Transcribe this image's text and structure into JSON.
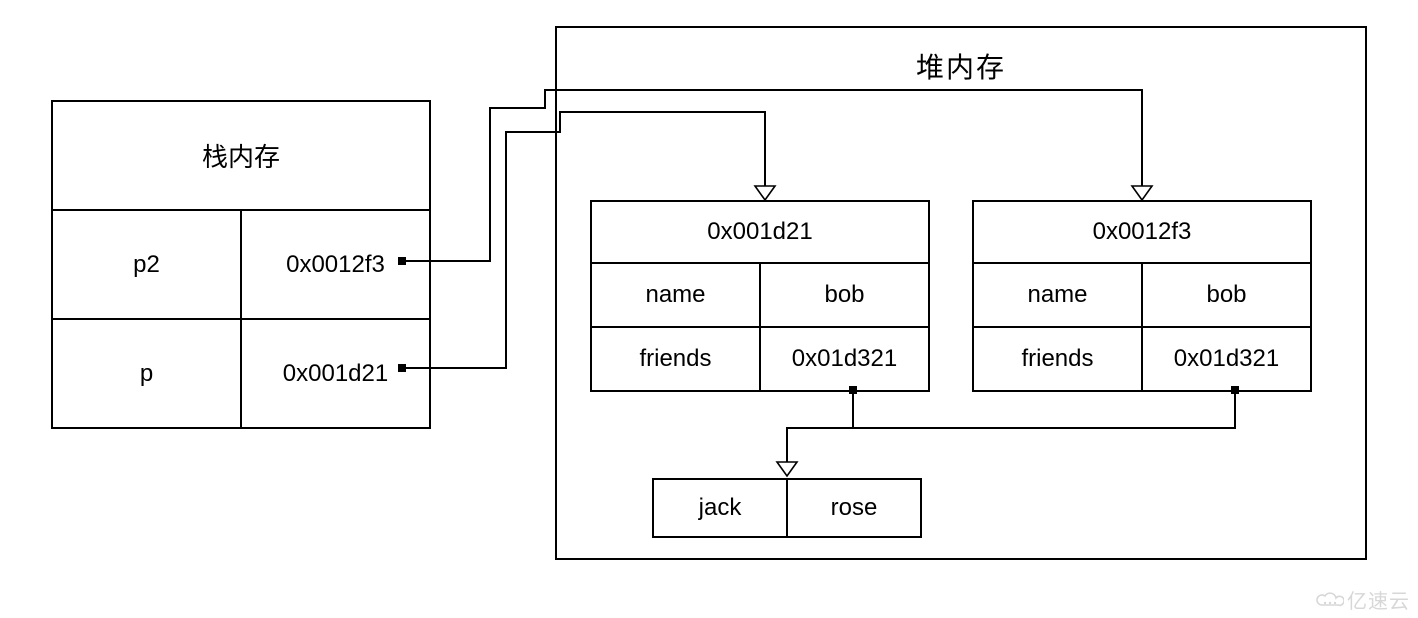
{
  "stack": {
    "title": "栈内存",
    "rows": [
      {
        "name": "p2",
        "value": "0x0012f3"
      },
      {
        "name": "p",
        "value": "0x001d21"
      }
    ]
  },
  "heap": {
    "title": "堆内存",
    "objects": [
      {
        "address": "0x001d21",
        "fields": [
          {
            "key": "name",
            "value": "bob"
          },
          {
            "key": "friends",
            "value": "0x01d321"
          }
        ]
      },
      {
        "address": "0x0012f3",
        "fields": [
          {
            "key": "name",
            "value": "bob"
          },
          {
            "key": "friends",
            "value": "0x01d321"
          }
        ]
      }
    ],
    "array": [
      "jack",
      "rose"
    ]
  },
  "watermark": "亿速云"
}
